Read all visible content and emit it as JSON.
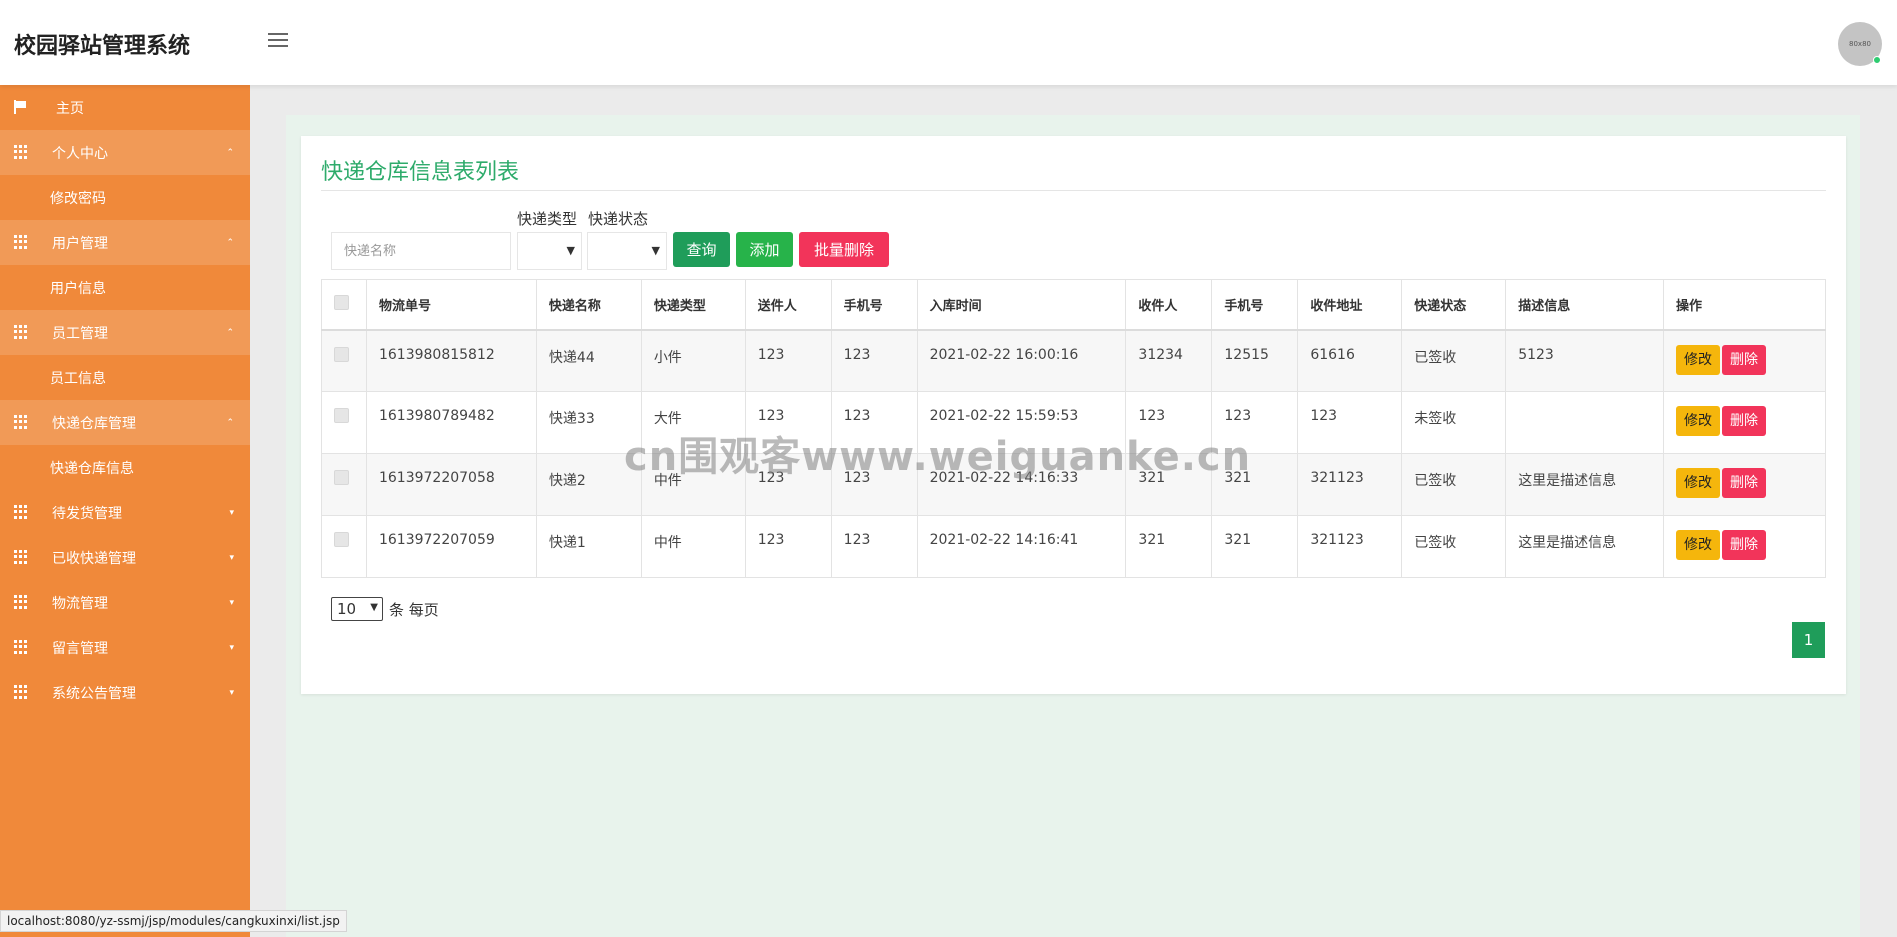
{
  "header": {
    "title": "校园驿站管理系统",
    "avatar_text": "80x80"
  },
  "sidebar": {
    "home": "主页",
    "groups": [
      {
        "label": "个人中心",
        "caret": "⌃",
        "sub": "修改密码"
      },
      {
        "label": "用户管理",
        "caret": "⌃",
        "sub": "用户信息"
      },
      {
        "label": "员工管理",
        "caret": "⌃",
        "sub": "员工信息"
      },
      {
        "label": "快递仓库管理",
        "caret": "⌃",
        "sub": "快递仓库信息"
      }
    ],
    "collapsed": [
      {
        "label": "待发货管理",
        "caret": "▾"
      },
      {
        "label": "已收快递管理",
        "caret": "▾"
      },
      {
        "label": "物流管理",
        "caret": "▾"
      },
      {
        "label": "留言管理",
        "caret": "▾"
      },
      {
        "label": "系统公告管理",
        "caret": "▾"
      }
    ]
  },
  "main": {
    "title": "快递仓库信息表列表",
    "filters": {
      "name_placeholder": "快递名称",
      "type_label": "快递类型",
      "status_label": "快递状态"
    },
    "buttons": {
      "query": "查询",
      "add": "添加",
      "batch_delete": "批量删除"
    },
    "table": {
      "headers": [
        "物流单号",
        "快递名称",
        "快递类型",
        "送件人",
        "手机号",
        "入库时间",
        "收件人",
        "手机号",
        "收件地址",
        "快递状态",
        "描述信息",
        "操作"
      ],
      "rows": [
        [
          "1613980815812",
          "快递44",
          "小件",
          "123",
          "123",
          "2021-02-22 16:00:16",
          "31234",
          "12515",
          "61616",
          "已签收",
          "5123"
        ],
        [
          "1613980789482",
          "快递33",
          "大件",
          "123",
          "123",
          "2021-02-22 15:59:53",
          "123",
          "123",
          "123",
          "未签收",
          ""
        ],
        [
          "1613972207058",
          "快递2",
          "中件",
          "123",
          "123",
          "2021-02-22 14:16:33",
          "321",
          "321",
          "321123",
          "已签收",
          "这里是描述信息"
        ],
        [
          "1613972207059",
          "快递1",
          "中件",
          "123",
          "123",
          "2021-02-22 14:16:41",
          "321",
          "321",
          "321123",
          "已签收",
          "这里是描述信息"
        ]
      ],
      "edit_label": "修改",
      "delete_label": "删除"
    },
    "pagination": {
      "page_size": "10",
      "page_size_suffix": "条 每页",
      "current_page": "1"
    }
  },
  "watermark": "cn围观客www.weiguanke.cn",
  "status_url": "localhost:8080/yz-ssmj/jsp/modules/cangkuxinxi/list.jsp",
  "colors": {
    "sidebar": "#f0893a",
    "accent_green": "#2eab6b",
    "danger": "#f2345a",
    "warning": "#f5b60c"
  }
}
